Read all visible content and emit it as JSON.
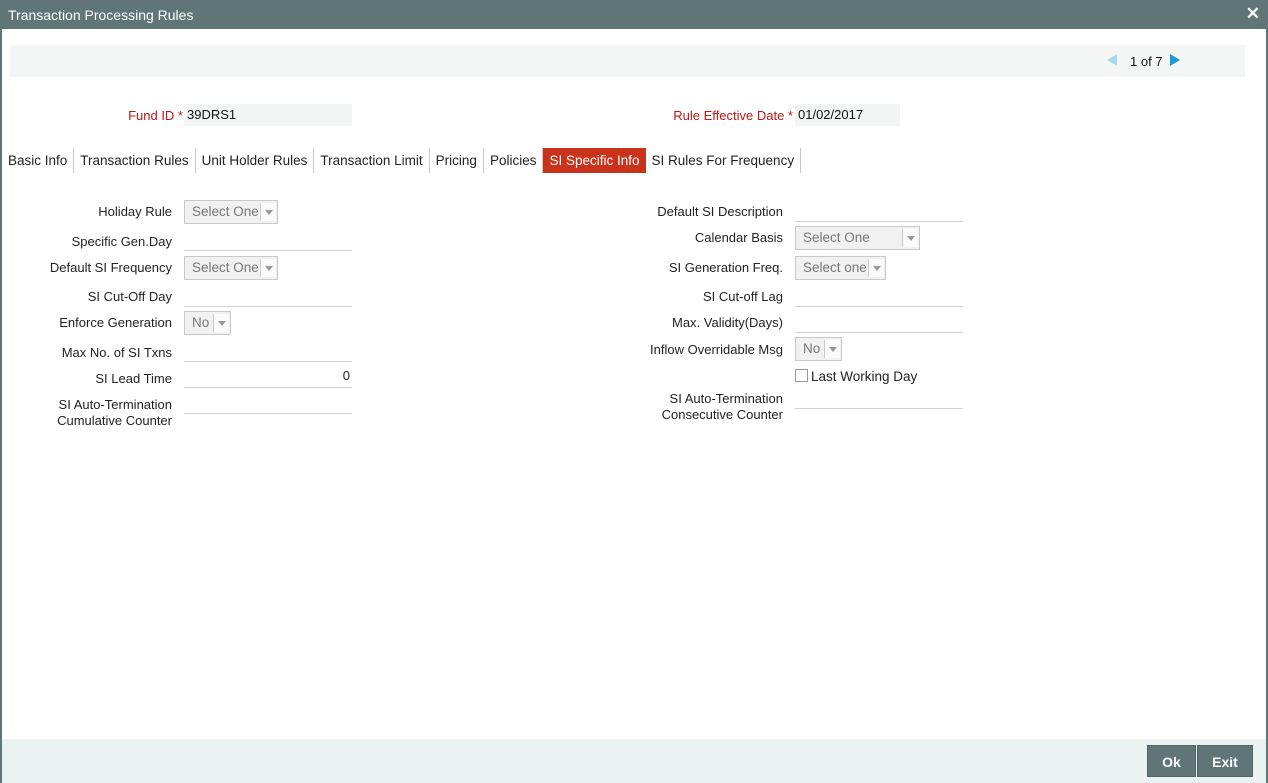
{
  "window": {
    "title": "Transaction Processing Rules",
    "close_glyph": "✕"
  },
  "pager": {
    "text": "1 of 7"
  },
  "header": {
    "fund_id_label": "Fund ID *",
    "fund_id_value": "39DRS1",
    "effective_date_label": "Rule Effective Date *",
    "effective_date_value": "01/02/2017"
  },
  "tabs": [
    {
      "label": "Basic Info"
    },
    {
      "label": "Transaction Rules"
    },
    {
      "label": "Unit Holder Rules"
    },
    {
      "label": "Transaction Limit"
    },
    {
      "label": "Pricing"
    },
    {
      "label": "Policies"
    },
    {
      "label": "SI Specific Info",
      "active": true
    },
    {
      "label": "SI Rules For Frequency"
    }
  ],
  "left": {
    "holiday_rule": {
      "label": "Holiday Rule",
      "value": "Select One"
    },
    "specific_gen_day": {
      "label": "Specific Gen.Day",
      "value": ""
    },
    "default_si_frequency": {
      "label": "Default SI Frequency",
      "value": "Select One"
    },
    "si_cutoff_day": {
      "label": "SI Cut-Off Day",
      "value": ""
    },
    "enforce_generation": {
      "label": "Enforce Generation",
      "value": "No"
    },
    "max_no_si_txns": {
      "label": "Max No. of SI Txns",
      "value": ""
    },
    "si_lead_time": {
      "label": "SI Lead Time",
      "value": "0"
    },
    "si_auto_term_cumulative": {
      "label_line1": "SI Auto-Termination",
      "label_line2": "Cumulative Counter",
      "value": ""
    }
  },
  "right": {
    "default_si_description": {
      "label": "Default SI Description",
      "value": ""
    },
    "calendar_basis": {
      "label": "Calendar Basis",
      "value": "Select One"
    },
    "si_generation_freq": {
      "label": "SI Generation Freq.",
      "value": "Select one"
    },
    "si_cutoff_lag": {
      "label": "SI Cut-off Lag",
      "value": ""
    },
    "max_validity_days": {
      "label": "Max. Validity(Days)",
      "value": ""
    },
    "inflow_overridable_msg": {
      "label": "Inflow Overridable Msg",
      "value": "No"
    },
    "last_working_day": {
      "label": "Last Working Day",
      "checked": false
    },
    "si_auto_term_consecutive": {
      "label_line1": "SI Auto-Termination",
      "label_line2": "Consecutive Counter",
      "value": ""
    }
  },
  "footer": {
    "ok_label": "Ok",
    "exit_label": "Exit"
  },
  "colors": {
    "titlebar": "#5f7576",
    "active_tab": "#c9331c",
    "mandatory_label": "#c41515",
    "pager_arrow": "#1a9ad6"
  }
}
